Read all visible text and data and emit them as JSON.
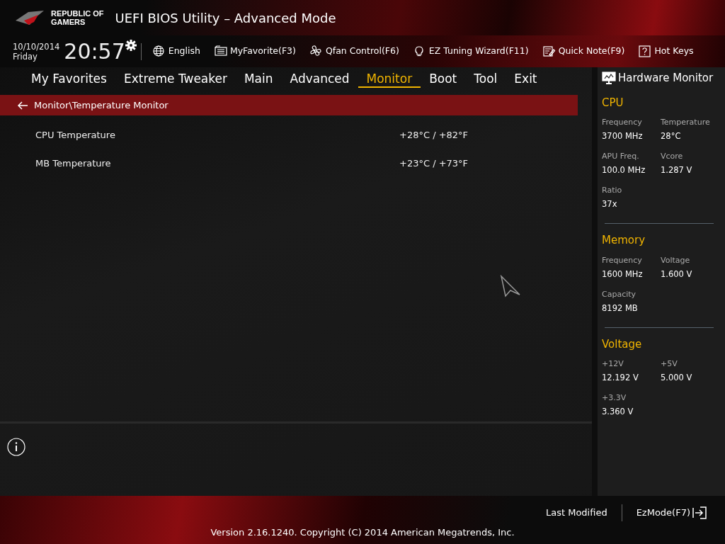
{
  "header": {
    "logo_lines": [
      "REPUBLIC OF",
      "GAMERS"
    ],
    "title": "UEFI BIOS Utility – Advanced Mode"
  },
  "toolbar": {
    "date": "10/10/2014",
    "day": "Friday",
    "time": "20:57",
    "items": [
      {
        "kind": "globe",
        "label": "English"
      },
      {
        "kind": "list",
        "label": "MyFavorite(F3)"
      },
      {
        "kind": "fan",
        "label": "Qfan Control(F6)"
      },
      {
        "kind": "bulb",
        "label": "EZ Tuning Wizard(F11)"
      },
      {
        "kind": "note",
        "label": "Quick Note(F9)"
      },
      {
        "kind": "help",
        "label": "Hot Keys"
      }
    ]
  },
  "tabs": [
    {
      "label": "My Favorites",
      "selected": false
    },
    {
      "label": "Extreme Tweaker",
      "selected": false
    },
    {
      "label": "Main",
      "selected": false
    },
    {
      "label": "Advanced",
      "selected": false
    },
    {
      "label": "Monitor",
      "selected": true
    },
    {
      "label": "Boot",
      "selected": false
    },
    {
      "label": "Tool",
      "selected": false
    },
    {
      "label": "Exit",
      "selected": false
    }
  ],
  "breadcrumb": "Monitor\\Temperature Monitor",
  "rows": [
    {
      "label": "CPU Temperature",
      "value": "+28°C / +82°F"
    },
    {
      "label": "MB Temperature",
      "value": "+23°C / +73°F"
    }
  ],
  "hardware_monitor": {
    "title": "Hardware Monitor",
    "sections": [
      {
        "title": "CPU",
        "items": [
          {
            "label": "Frequency",
            "value": "3700 MHz"
          },
          {
            "label": "Temperature",
            "value": "28°C"
          },
          {
            "label": "APU Freq.",
            "value": "100.0 MHz"
          },
          {
            "label": "Vcore",
            "value": "1.287 V"
          },
          {
            "label": "Ratio",
            "value": "37x"
          }
        ]
      },
      {
        "title": "Memory",
        "items": [
          {
            "label": "Frequency",
            "value": "1600 MHz"
          },
          {
            "label": "Voltage",
            "value": "1.600 V"
          },
          {
            "label": "Capacity",
            "value": "8192 MB"
          }
        ]
      },
      {
        "title": "Voltage",
        "items": [
          {
            "label": "+12V",
            "value": "12.192 V"
          },
          {
            "label": "+5V",
            "value": "5.000 V"
          },
          {
            "label": "+3.3V",
            "value": "3.360 V"
          }
        ]
      }
    ]
  },
  "footer": {
    "links": [
      "Last Modified",
      "EzMode(F7)"
    ],
    "version": "Version 2.16.1240. Copyright (C) 2014 American Megatrends, Inc."
  }
}
